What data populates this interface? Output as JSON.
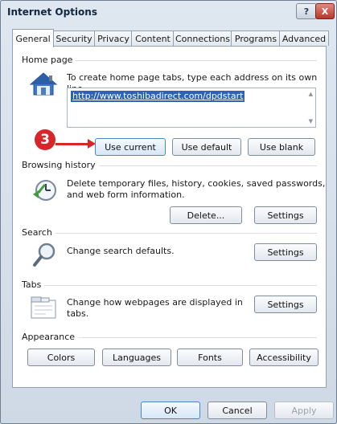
{
  "window": {
    "title": "Internet Options",
    "help_label": "?",
    "close_label": "X"
  },
  "tabs": [
    "General",
    "Security",
    "Privacy",
    "Content",
    "Connections",
    "Programs",
    "Advanced"
  ],
  "home_page": {
    "group_label": "Home page",
    "description": "To create home page tabs, type each address on its own line.",
    "url": "http://www.toshibadirect.com/dpdstart",
    "buttons": {
      "use_current": "Use current",
      "use_default": "Use default",
      "use_blank": "Use blank"
    },
    "step_number": "3"
  },
  "browsing_history": {
    "group_label": "Browsing history",
    "description_line1": "Delete temporary files, history, cookies, saved passwords,",
    "description_line2": "and web form information.",
    "delete_label": "Delete...",
    "settings_label": "Settings"
  },
  "search": {
    "group_label": "Search",
    "description": "Change search defaults.",
    "settings_label": "Settings"
  },
  "tabs_section": {
    "group_label": "Tabs",
    "description_line1": "Change how webpages are displayed in",
    "description_line2": "tabs.",
    "settings_label": "Settings"
  },
  "appearance": {
    "group_label": "Appearance",
    "buttons": [
      "Colors",
      "Languages",
      "Fonts",
      "Accessibility"
    ]
  },
  "footer": {
    "ok_label": "OK",
    "cancel_label": "Cancel",
    "apply_label": "Apply"
  },
  "icons": [
    "house-icon",
    "history-clock-icon",
    "magnifier-icon",
    "tabs-icon"
  ]
}
